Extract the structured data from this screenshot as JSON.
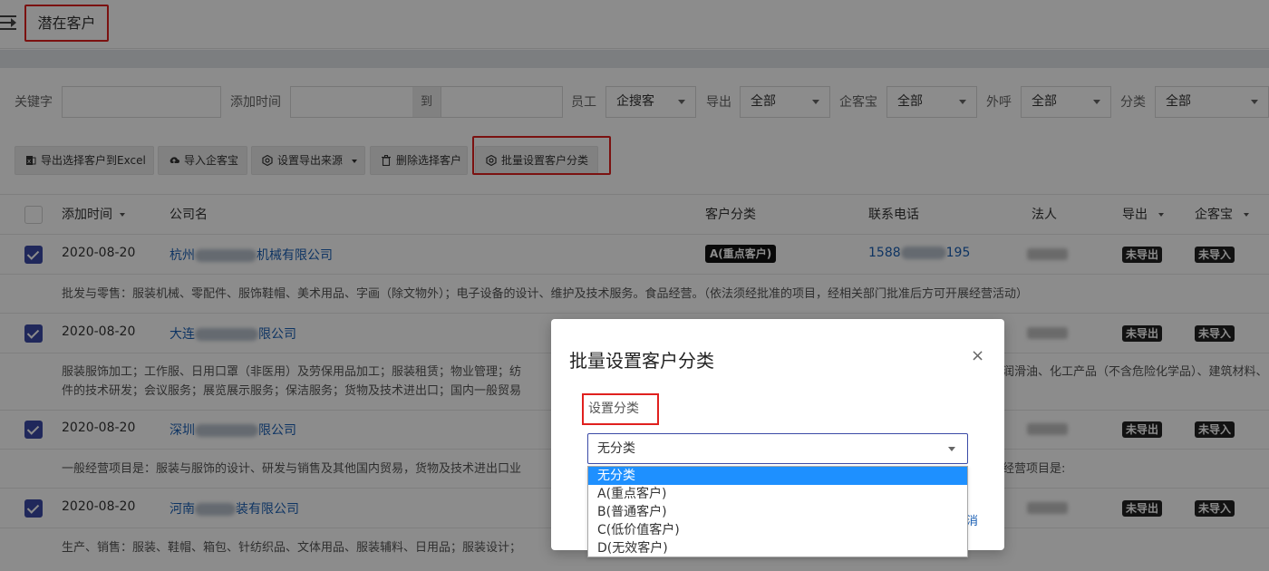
{
  "header": {
    "title": "潜在客户"
  },
  "filters": {
    "keyword_label": "关键字",
    "keyword_value": "",
    "add_time_label": "添加时间",
    "add_time_to": "到",
    "employee_label": "员工",
    "employee_value": "企搜客",
    "export_label": "导出",
    "export_value": "全部",
    "qikebao_label": "企客宝",
    "qikebao_value": "全部",
    "call_label": "外呼",
    "call_value": "全部",
    "category_label": "分类",
    "category_value": "全部"
  },
  "toolbar": {
    "export_excel": "导出选择客户到Excel",
    "import_qikebao": "导入企客宝",
    "set_export_source": "设置导出来源",
    "delete_selected": "删除选择客户",
    "batch_set_category": "批量设置客户分类"
  },
  "table": {
    "columns": {
      "add_time": "添加时间",
      "company": "公司名",
      "category": "客户分类",
      "phone": "联系电话",
      "legal_person": "法人",
      "exported": "导出",
      "qikebao": "企客宝"
    },
    "rows": [
      {
        "date": "2020-08-20",
        "company_prefix": "杭州",
        "company_suffix": "机械有限公司",
        "category": "A(重点客户)",
        "phone_prefix": "1588",
        "phone_suffix": "195",
        "exported": "未导出",
        "qikebao": "未导入",
        "description": "批发与零售：服装机械、零配件、服饰鞋帽、美术用品、字画（除文物外）；电子设备的设计、维护及技术服务。食品经营。（依法须经批准的项目，经相关部门批准后方可开展经营活动）"
      },
      {
        "date": "2020-08-20",
        "company_prefix": "大连",
        "company_suffix": "限公司",
        "category": "",
        "exported": "未导出",
        "qikebao": "未导入",
        "description": "服装服饰加工；工作服、日用口罩（非医用）及劳保用品加工；服装租赁；物业管理；纺",
        "description_right": "润滑油、化工产品（不含危险化学品）、建筑材料、",
        "description2": "件的技术研发；会议服务；展览展示服务；保洁服务；货物及技术进出口；国内一般贸易"
      },
      {
        "date": "2020-08-20",
        "company_prefix": "深圳",
        "company_suffix": "限公司",
        "category": "",
        "exported": "未导出",
        "qikebao": "未导入",
        "description": "一般经营项目是：服装与服饰的设计、研发与销售及其他国内贸易，货物及技术进出口业",
        "description_right": "经营项目是:"
      },
      {
        "date": "2020-08-20",
        "company_prefix": "河南",
        "company_suffix": "装有限公司",
        "category": "",
        "exported": "未导出",
        "qikebao": "未导入",
        "description": "生产、销售：服装、鞋帽、箱包、针纺织品、文体用品、服装辅料、日用品；服装设计；"
      }
    ]
  },
  "modal": {
    "title": "批量设置客户分类",
    "close_symbol": "×",
    "field_label": "设置分类",
    "selected_value": "无分类",
    "cancel_fragment": "消",
    "options": [
      "无分类",
      "A(重点客户)",
      "B(普通客户)",
      "C(低价值客户)",
      "D(无效客户)"
    ]
  }
}
